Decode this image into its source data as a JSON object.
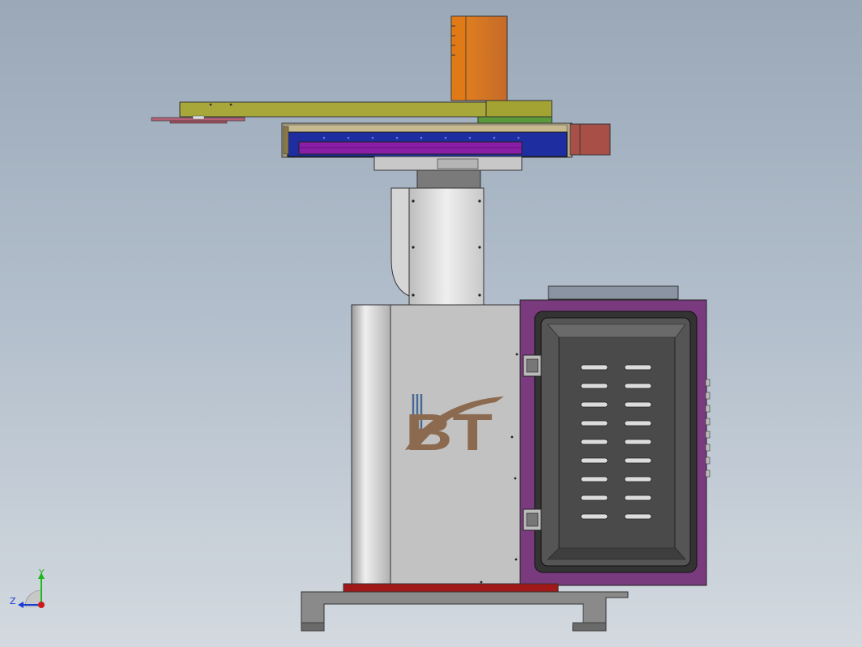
{
  "view": {
    "background_top": "#9aa8b8",
    "background_bottom": "#d3d9df"
  },
  "logo": {
    "text": "BT",
    "primary_color": "#8b6a4f",
    "accent_color": "#4a6a96"
  },
  "triad": {
    "x_label": "",
    "y_label": "Y",
    "z_label": "Z",
    "y_color": "#1cb81c",
    "z_color": "#1a3bd6",
    "origin_color": "#cc1a1a"
  },
  "parts": {
    "motor_top": "#d9772a",
    "upper_arm": "#a6a63a",
    "green_block": "#5a9a3a",
    "blue_rail": "#1e2ea0",
    "purple_slider": "#8a1ea6",
    "side_motor": "#a85048",
    "cabinet_frame": "#7a3a7e",
    "base_plate": "#a01818"
  }
}
